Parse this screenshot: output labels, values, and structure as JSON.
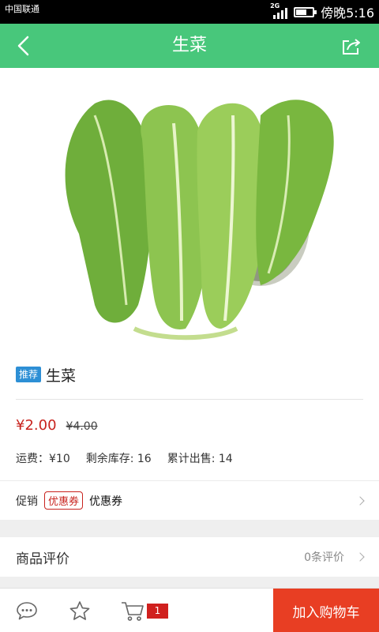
{
  "status_bar": {
    "carrier": "中国联通",
    "network": "2G",
    "time": "傍晚5:16",
    "battery_level": 0.65
  },
  "nav": {
    "title": "生菜"
  },
  "product": {
    "badge": "推荐",
    "name": "生菜",
    "price": "¥2.00",
    "original_price": "¥4.00",
    "shipping": "运费：¥10",
    "stock": "剩余库存: 16",
    "sold": "累计出售: 14"
  },
  "promo": {
    "label": "促销",
    "coupon_tag": "优惠券",
    "coupon_text": "优惠券"
  },
  "reviews": {
    "label": "商品评价",
    "count": "0条评价"
  },
  "bottom_bar": {
    "cart_count": "1",
    "add_to_cart": "加入购物车"
  },
  "colors": {
    "primary": "#48c77b",
    "price_red": "#c8231e",
    "cta": "#e83e23",
    "badge_blue": "#2d8fd5"
  },
  "icons": [
    "back-arrow-icon",
    "share-icon",
    "chat-icon",
    "star-icon",
    "cart-icon",
    "chevron-right-icon"
  ]
}
